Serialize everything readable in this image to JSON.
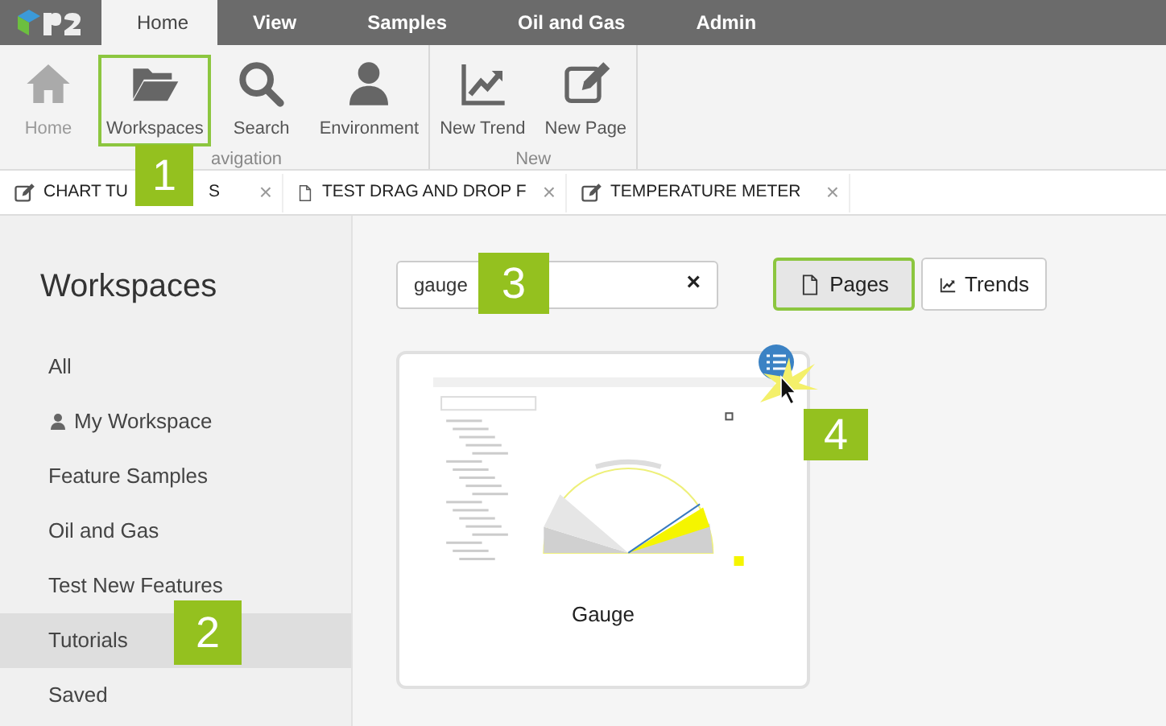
{
  "menu_tabs": [
    {
      "label": "Home",
      "selected": true
    },
    {
      "label": "View",
      "selected": false
    },
    {
      "label": "Samples",
      "selected": false
    },
    {
      "label": "Oil and Gas",
      "selected": false
    },
    {
      "label": "Admin",
      "selected": false
    }
  ],
  "ribbon_groups": [
    {
      "label": "avigation",
      "buttons": [
        {
          "label": "Home",
          "kind": "home",
          "disabled": true,
          "highlighted": false
        },
        {
          "label": "Workspaces",
          "kind": "folder",
          "disabled": false,
          "highlighted": true
        },
        {
          "label": "Search",
          "kind": "search",
          "disabled": false,
          "highlighted": false
        },
        {
          "label": "Environment",
          "kind": "person",
          "disabled": false,
          "highlighted": false
        }
      ]
    },
    {
      "label": "New",
      "buttons": [
        {
          "label": "New Trend",
          "kind": "trend",
          "disabled": false,
          "highlighted": false
        },
        {
          "label": "New Page",
          "kind": "edit",
          "disabled": false,
          "highlighted": false
        }
      ]
    }
  ],
  "doc_tabs": [
    {
      "kind": "edit",
      "label": "CHART TU",
      "label_tail": "S",
      "close": "×"
    },
    {
      "kind": "page",
      "label": "TEST DRAG AND DROP F",
      "close": "×"
    },
    {
      "kind": "edit",
      "label": "TEMPERATURE METER",
      "close": "×"
    }
  ],
  "sidebar": {
    "title": "Workspaces",
    "items": [
      {
        "label": "All",
        "kind": "plain",
        "selected": false
      },
      {
        "label": "My Workspace",
        "kind": "person",
        "selected": false
      },
      {
        "label": "Feature Samples",
        "kind": "plain",
        "selected": false
      },
      {
        "label": "Oil and Gas",
        "kind": "plain",
        "selected": false
      },
      {
        "label": "Test New Features",
        "kind": "plain",
        "selected": false
      },
      {
        "label": "Tutorials",
        "kind": "plain",
        "selected": true
      },
      {
        "label": "Saved",
        "kind": "plain",
        "selected": false
      }
    ]
  },
  "search": {
    "value": "gauge",
    "clear": "×"
  },
  "view_toggle": [
    {
      "label": "Pages",
      "kind": "page",
      "selected": true
    },
    {
      "label": "Trends",
      "kind": "trend",
      "selected": false
    }
  ],
  "cards": [
    {
      "title": "Gauge"
    }
  ],
  "callouts": [
    "1",
    "2",
    "3",
    "4"
  ]
}
